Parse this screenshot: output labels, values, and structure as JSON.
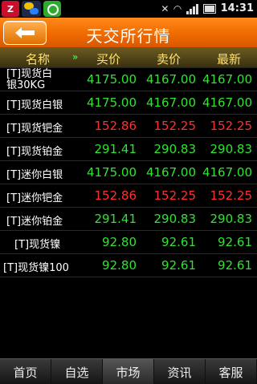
{
  "statusbar": {
    "app_icon_letter": "Z",
    "time": "14:31"
  },
  "header": {
    "title": "天交所行情",
    "back_icon": "back-arrow-icon"
  },
  "columns": {
    "name": "名称",
    "buy": "买价",
    "sell": "卖价",
    "last": "最新",
    "scroll_arrow": "»"
  },
  "rows": [
    {
      "name_line1": "[T]现货白",
      "name_line2": "银30KG",
      "buy": "4175.00",
      "sell": "4167.00",
      "last": "4167.00",
      "color": "green"
    },
    {
      "name": "[T]现货白银",
      "buy": "4175.00",
      "sell": "4167.00",
      "last": "4167.00",
      "color": "green"
    },
    {
      "name": "[T]现货钯金",
      "buy": "152.86",
      "sell": "152.25",
      "last": "152.25",
      "color": "red"
    },
    {
      "name": "[T]现货铂金",
      "buy": "291.41",
      "sell": "290.83",
      "last": "290.83",
      "color": "green"
    },
    {
      "name": "[T]迷你白银",
      "buy": "4175.00",
      "sell": "4167.00",
      "last": "4167.00",
      "color": "green"
    },
    {
      "name": "[T]迷你钯金",
      "buy": "152.86",
      "sell": "152.25",
      "last": "152.25",
      "color": "red"
    },
    {
      "name": "[T]迷你铂金",
      "buy": "291.41",
      "sell": "290.83",
      "last": "290.83",
      "color": "green"
    },
    {
      "name": "[T]现货镍",
      "buy": "92.80",
      "sell": "92.61",
      "last": "92.61",
      "color": "green"
    },
    {
      "name": "[T]现货镍100",
      "buy": "92.80",
      "sell": "92.61",
      "last": "92.61",
      "color": "green"
    }
  ],
  "tabs": [
    {
      "label": "首页",
      "active": false
    },
    {
      "label": "自选",
      "active": false
    },
    {
      "label": "市场",
      "active": true
    },
    {
      "label": "资讯",
      "active": false
    },
    {
      "label": "客服",
      "active": false
    }
  ],
  "colors": {
    "header_orange": "#f06a00",
    "up_green": "#35e035",
    "down_red": "#ff3030",
    "column_header_text": "#ffe070"
  }
}
